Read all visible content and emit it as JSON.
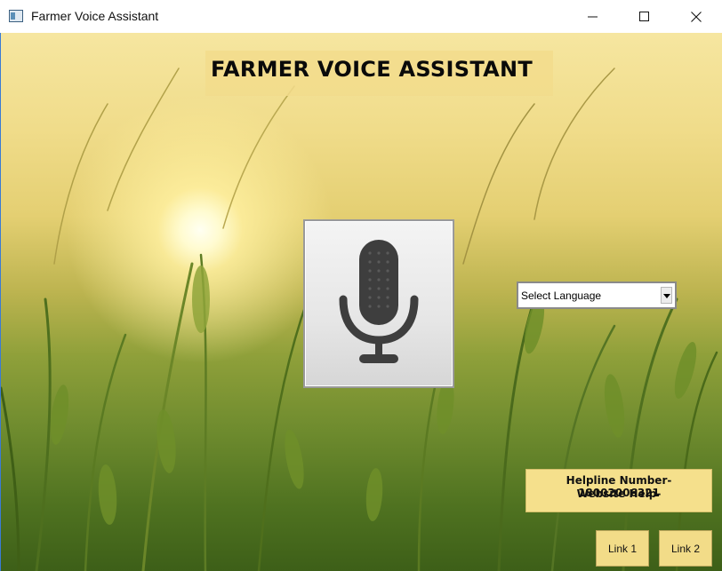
{
  "window": {
    "title": "Farmer Voice Assistant",
    "icons": {
      "app": "app-window-icon",
      "minimize": "minimize-icon",
      "maximize": "maximize-icon",
      "close": "close-icon"
    }
  },
  "main": {
    "heading": "FARMER VOICE ASSISTANT",
    "mic_icon": "microphone-icon",
    "language_select": {
      "value": "Select Language",
      "arrow_icon": "chevron-down-icon"
    },
    "helpline": {
      "line1": "Helpline Number- 18002006321",
      "line2": "Website Help-"
    },
    "links": [
      "Link 1",
      "Link 2"
    ]
  },
  "colors": {
    "title_panel": "#f2dc8c",
    "helpline_bg": "#f5e08c",
    "link_bg": "#f2dc88"
  }
}
